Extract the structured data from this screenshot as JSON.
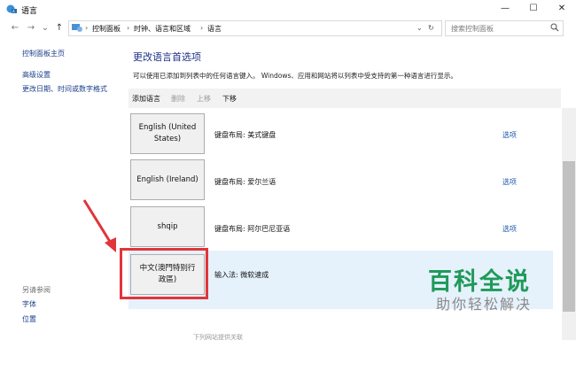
{
  "window": {
    "title": "语言",
    "minimize": "—",
    "maximize": "☐",
    "close": "✕"
  },
  "address": {
    "root": "控制面板",
    "sep": "›",
    "part2": "时钟、语言和区域",
    "part3": "语言",
    "refresh": "↻",
    "dropdown": "⌄"
  },
  "search": {
    "placeholder": "搜索控制面板"
  },
  "nav": {
    "back": "←",
    "forward": "→",
    "dropdown": "⌄",
    "up": "↑"
  },
  "left": {
    "home": "控制面板主页",
    "advanced": "高级设置",
    "change_datetime": "更改日期、时间或数字格式",
    "see_also": "另请参阅",
    "fonts": "字体",
    "location": "位置"
  },
  "main": {
    "heading": "更改语言首选项",
    "description": "可以使用已添加到列表中的任何语言键入。 Windows、应用和网站将以列表中受支持的第一种语言进行显示。"
  },
  "toolbar": {
    "add": "添加语言",
    "remove": "删除",
    "up": "上移",
    "down": "下移"
  },
  "languages": [
    {
      "name_l1": "English (United",
      "name_l2": "States)",
      "input": "键盘布局: 美式键盘",
      "options": "选项"
    },
    {
      "name_l1": "English (Ireland)",
      "name_l2": "",
      "input": "键盘布局: 爱尔兰语",
      "options": "选项"
    },
    {
      "name_l1": "shqip",
      "name_l2": "",
      "input": "键盘布局: 阿尔巴尼亚语",
      "options": "选项"
    },
    {
      "name_l1": "中文(澳門特别行",
      "name_l2": "政區)",
      "input": "输入法: 微软速成",
      "options": ""
    }
  ],
  "watermark": {
    "line1": "百科全说",
    "line2": "助你轻松解决"
  },
  "footer": {
    "partial": "下列网站提供关联"
  },
  "colors": {
    "link": "#1b56a8",
    "heading": "#1e3287",
    "highlight": "#e5f1fb",
    "annotation": "#e0353b",
    "watermark": "#1f9a5a"
  }
}
